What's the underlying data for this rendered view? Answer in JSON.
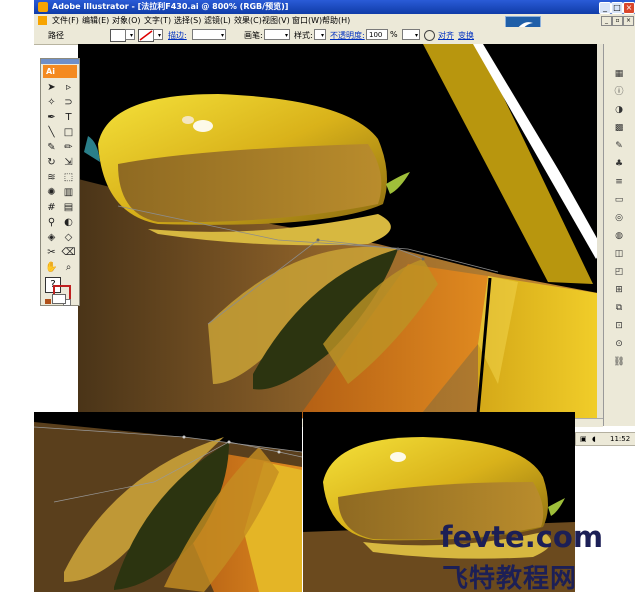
{
  "window": {
    "title": "Adobe Illustrator - [法拉利F430.ai @ 800% (RGB/预览)]",
    "app_icon": "Ai"
  },
  "menubar": {
    "items": [
      "文件(F)",
      "编辑(E)",
      "对象(O)",
      "文字(T)",
      "选择(S)",
      "滤镜(L)",
      "效果(C)",
      "视图(V)",
      "窗口(W)",
      "帮助(H)"
    ]
  },
  "options_bar": {
    "selection_label": "路径",
    "stroke_label": "描边:",
    "brush_label": "画笔:",
    "style_label": "样式:",
    "opacity_label": "不透明度:",
    "opacity_value": "100",
    "percent": "%",
    "align_link": "对齐",
    "transform_link": "变换"
  },
  "toolbox": {
    "badge": "Ai",
    "tools": [
      "selection-arrow",
      "direct-selection",
      "magic-wand",
      "lasso",
      "pen",
      "type",
      "line",
      "rectangle",
      "paintbrush",
      "pencil",
      "rotate",
      "scale",
      "warp",
      "free-transform",
      "symbol-sprayer",
      "graph",
      "mesh",
      "gradient",
      "eyedropper",
      "blend",
      "live-paint",
      "live-paint-select",
      "slice",
      "eraser",
      "hand",
      "zoom"
    ],
    "fill_stroke_glyph": "?"
  },
  "status_bar": {
    "time": "11:52"
  },
  "watermark": {
    "domain": "fevte.com",
    "site_name": "飞特教程网"
  },
  "colors": {
    "title_blue": "#0f3ca8",
    "chrome": "#ece9d8",
    "mirror_yellow": "#e0b81c",
    "body_orange": "#c8741a",
    "watermark_navy": "#1c1f56"
  }
}
